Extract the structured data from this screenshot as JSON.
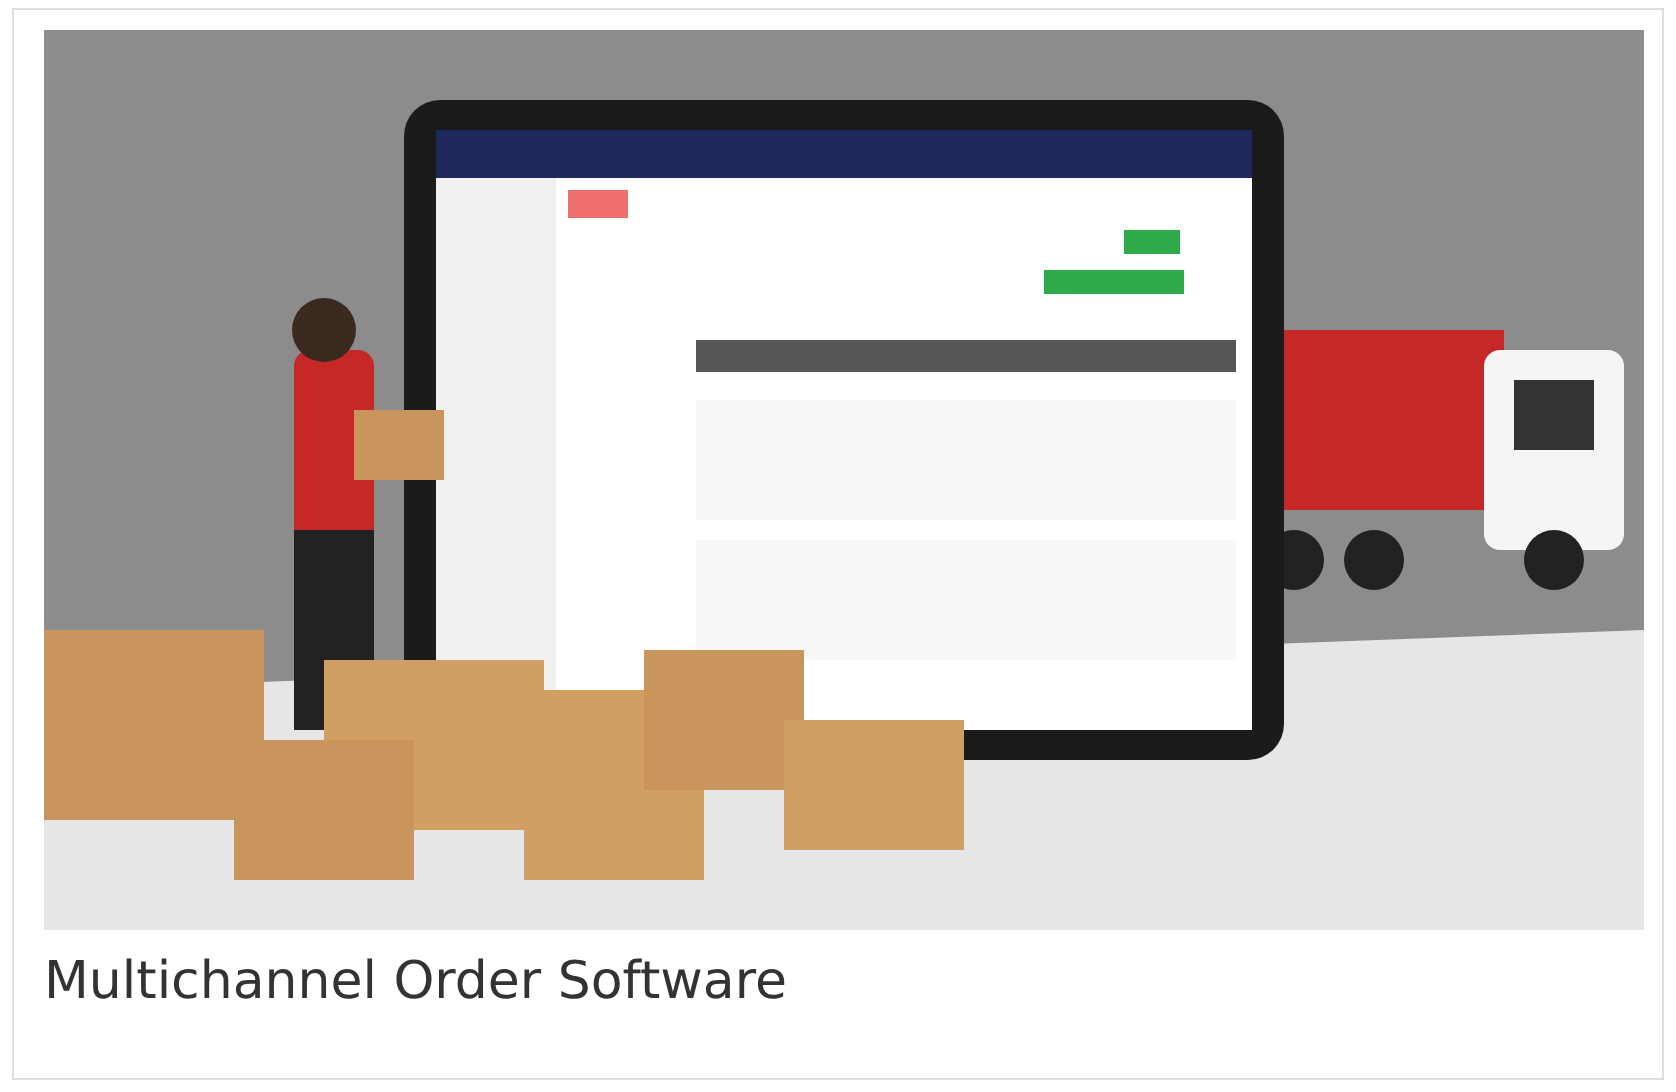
{
  "card": {
    "caption": "Multichannel Order Software"
  }
}
